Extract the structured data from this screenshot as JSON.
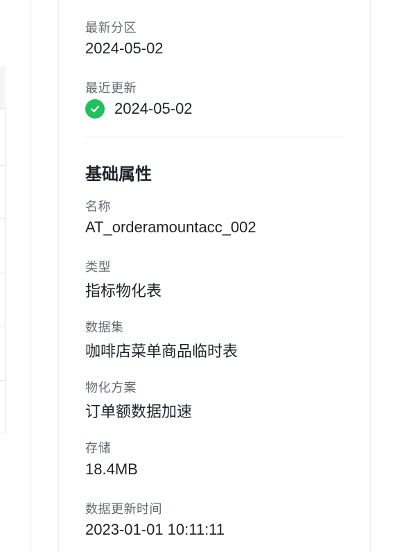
{
  "partition": {
    "label": "最新分区",
    "value": "2024-05-02"
  },
  "recent_update": {
    "label": "最近更新",
    "value": "2024-05-02",
    "status_icon": "check-circle-icon",
    "status_color": "#20c05c"
  },
  "basic_properties": {
    "title": "基础属性",
    "fields": [
      {
        "label": "名称",
        "value": "AT_orderamountacc_002"
      },
      {
        "label": "类型",
        "value": "指标物化表"
      },
      {
        "label": "数据集",
        "value": "咖啡店菜单商品临时表"
      },
      {
        "label": "物化方案",
        "value": "订单额数据加速"
      },
      {
        "label": "存储",
        "value": "18.4MB"
      },
      {
        "label": "数据更新时间",
        "value": "2023-01-01 10:11:11"
      }
    ]
  }
}
